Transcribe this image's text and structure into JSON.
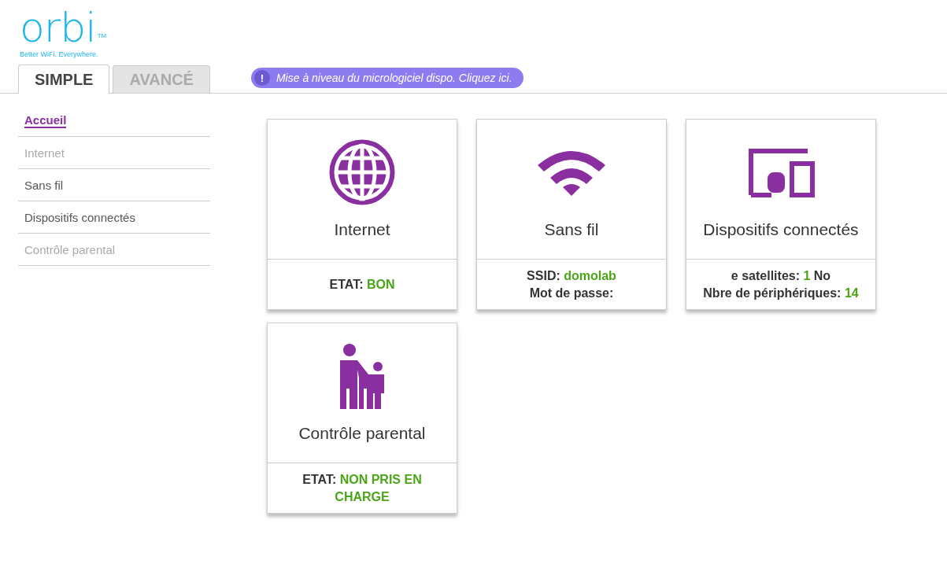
{
  "logo": {
    "wordmark": "orbi",
    "trademark": "TM",
    "tagline": "Better WiFi. Everywhere."
  },
  "tabs": [
    {
      "label": "SIMPLE",
      "selected": true
    },
    {
      "label": "AVANCÉ",
      "selected": false
    }
  ],
  "banner": {
    "icon": "!",
    "text": "Mise à niveau du micrologiciel dispo. Cliquez ici."
  },
  "sidebar": {
    "items": [
      {
        "label": "Accueil",
        "selected": true,
        "disabled": false
      },
      {
        "label": "Internet",
        "selected": false,
        "disabled": true
      },
      {
        "label": "Sans fil",
        "selected": false,
        "disabled": false
      },
      {
        "label": "Dispositifs connectés",
        "selected": false,
        "disabled": false
      },
      {
        "label": "Contrôle parental",
        "selected": false,
        "disabled": true
      }
    ]
  },
  "cards": [
    {
      "kind": "globe",
      "title": "Internet",
      "lines": [
        [
          {
            "text": "ETAT: ",
            "highlight": false
          },
          {
            "text": "BON",
            "highlight": true
          }
        ]
      ]
    },
    {
      "kind": "wifi",
      "title": "Sans fil",
      "lines": [
        [
          {
            "text": "SSID: ",
            "highlight": false
          },
          {
            "text": "domolab",
            "highlight": true
          }
        ],
        [
          {
            "text": "Mot de passe:",
            "highlight": false
          }
        ]
      ]
    },
    {
      "kind": "devices",
      "title": "Dispositifs connectés",
      "lines": [
        [
          {
            "text": "e satellites: ",
            "highlight": false
          },
          {
            "text": "1",
            "highlight": true
          },
          {
            "text": " No",
            "highlight": false
          }
        ],
        [
          {
            "text": "Nbre de périphériques: ",
            "highlight": false
          },
          {
            "text": "14",
            "highlight": true
          }
        ]
      ]
    },
    {
      "kind": "parental",
      "title": "Contrôle parental",
      "lines": [
        [
          {
            "text": "ETAT: ",
            "highlight": false
          },
          {
            "text": "NON PRIS EN CHARGE",
            "highlight": true
          }
        ]
      ]
    }
  ]
}
